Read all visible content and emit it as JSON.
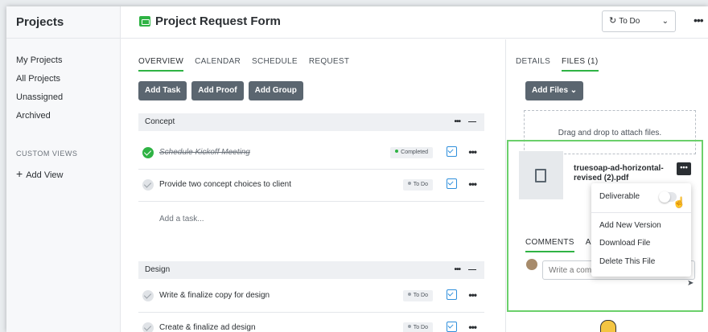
{
  "sidebar": {
    "title": "Projects",
    "items": [
      "My Projects",
      "All Projects",
      "Unassigned",
      "Archived"
    ],
    "section_label": "CUSTOM VIEWS",
    "add_view": "Add View"
  },
  "header": {
    "title": "Project Request Form",
    "status": "To Do"
  },
  "main": {
    "tabs": [
      "OVERVIEW",
      "CALENDAR",
      "SCHEDULE",
      "REQUEST"
    ],
    "buttons": [
      "Add Task",
      "Add Proof",
      "Add Group"
    ],
    "groups": [
      {
        "name": "Concept",
        "tasks": [
          {
            "name": "Schedule Kickoff Meeting",
            "status": "Completed",
            "done": true
          },
          {
            "name": "Provide two concept choices to client",
            "status": "To Do",
            "done": false
          }
        ],
        "add_task_placeholder": "Add a task..."
      },
      {
        "name": "Design",
        "tasks": [
          {
            "name": "Write & finalize copy for design",
            "status": "To Do",
            "done": false
          },
          {
            "name": "Create & finalize ad design",
            "status": "To Do",
            "done": false
          }
        ]
      }
    ]
  },
  "right_panel": {
    "tabs": [
      "DETAILS",
      "FILES (1)"
    ],
    "add_files": "Add Files",
    "dropzone_text": "Drag and drop to attach files.",
    "file": {
      "name": "truesoap-ad-horizontal-revised (2).pdf"
    },
    "comment_tabs": [
      "COMMENTS",
      "AC"
    ],
    "comment_placeholder": "Write a comment"
  },
  "file_menu": {
    "deliverable": "Deliverable",
    "items": [
      "Add New Version",
      "Download File",
      "Delete This File"
    ]
  },
  "colors": {
    "accent": "#2fb344",
    "button": "#5b6670",
    "highlight": "#6bd06b",
    "proof": "#2f8fdc"
  }
}
